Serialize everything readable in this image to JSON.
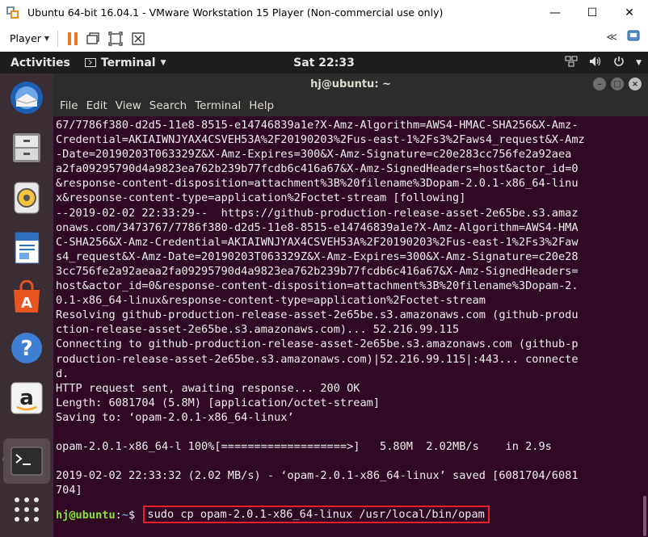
{
  "host_window": {
    "title": "Ubuntu 64-bit 16.04.1 - VMware Workstation 15 Player (Non-commercial use only)",
    "controls": {
      "minimize": "—",
      "maximize": "☐",
      "close": "✕"
    }
  },
  "vmware_toolbar": {
    "player_label": "Player",
    "right_glyph": "≪"
  },
  "ubuntu_panel": {
    "activities": "Activities",
    "app_name": "Terminal",
    "clock": "Sat 22:33"
  },
  "dock": {
    "items": [
      "thunderbird-icon",
      "files-icon",
      "rhythmbox-icon",
      "libreoffice-writer-icon",
      "software-center-icon",
      "help-icon",
      "amazon-icon",
      "terminal-icon",
      "show-apps-icon"
    ]
  },
  "terminal": {
    "title": "hj@ubuntu: ~",
    "menu": [
      "File",
      "Edit",
      "View",
      "Search",
      "Terminal",
      "Help"
    ],
    "output_lines": [
      "67/7786f380-d2d5-11e8-8515-e14746839a1e?X-Amz-Algorithm=AWS4-HMAC-SHA256&X-Amz-",
      "Credential=AKIAIWNJYAX4CSVEH53A%2F20190203%2Fus-east-1%2Fs3%2Faws4_request&X-Amz",
      "-Date=20190203T063329Z&X-Amz-Expires=300&X-Amz-Signature=c20e283cc756fe2a92aea",
      "a2fa09295790d4a9823ea762b239b77fcdb6c416a67&X-Amz-SignedHeaders=host&actor_id=0",
      "&response-content-disposition=attachment%3B%20filename%3Dopam-2.0.1-x86_64-linu",
      "x&response-content-type=application%2Foctet-stream [following]",
      "--2019-02-02 22:33:29--  https://github-production-release-asset-2e65be.s3.amaz",
      "onaws.com/3473767/7786f380-d2d5-11e8-8515-e14746839a1e?X-Amz-Algorithm=AWS4-HMA",
      "C-SHA256&X-Amz-Credential=AKIAIWNJYAX4CSVEH53A%2F20190203%2Fus-east-1%2Fs3%2Faw",
      "s4_request&X-Amz-Date=20190203T063329Z&X-Amz-Expires=300&X-Amz-Signature=c20e28",
      "3cc756fe2a92aeaa2fa09295790d4a9823ea762b239b77fcdb6c416a67&X-Amz-SignedHeaders=",
      "host&actor_id=0&response-content-disposition=attachment%3B%20filename%3Dopam-2.",
      "0.1-x86_64-linux&response-content-type=application%2Foctet-stream",
      "Resolving github-production-release-asset-2e65be.s3.amazonaws.com (github-produ",
      "ction-release-asset-2e65be.s3.amazonaws.com)... 52.216.99.115",
      "Connecting to github-production-release-asset-2e65be.s3.amazonaws.com (github-p",
      "roduction-release-asset-2e65be.s3.amazonaws.com)|52.216.99.115|:443... connecte",
      "d.",
      "HTTP request sent, awaiting response... 200 OK",
      "Length: 6081704 (5.8M) [application/octet-stream]",
      "Saving to: ‘opam-2.0.1-x86_64-linux’",
      "",
      "opam-2.0.1-x86_64-l 100%[===================>]   5.80M  2.02MB/s    in 2.9s",
      "",
      "2019-02-02 22:33:32 (2.02 MB/s) - ‘opam-2.0.1-x86_64-linux’ saved [6081704/6081",
      "704]",
      ""
    ],
    "prompt": {
      "user_host": "hj@ubuntu",
      "colon": ":",
      "path": "~",
      "symbol": "$ ",
      "command": "sudo cp opam-2.0.1-x86_64-linux /usr/local/bin/opam"
    },
    "colors": {
      "background": "#300a24",
      "prompt_user": "#8ae234",
      "prompt_path": "#729fcf",
      "highlight_box": "#e8202a"
    }
  }
}
